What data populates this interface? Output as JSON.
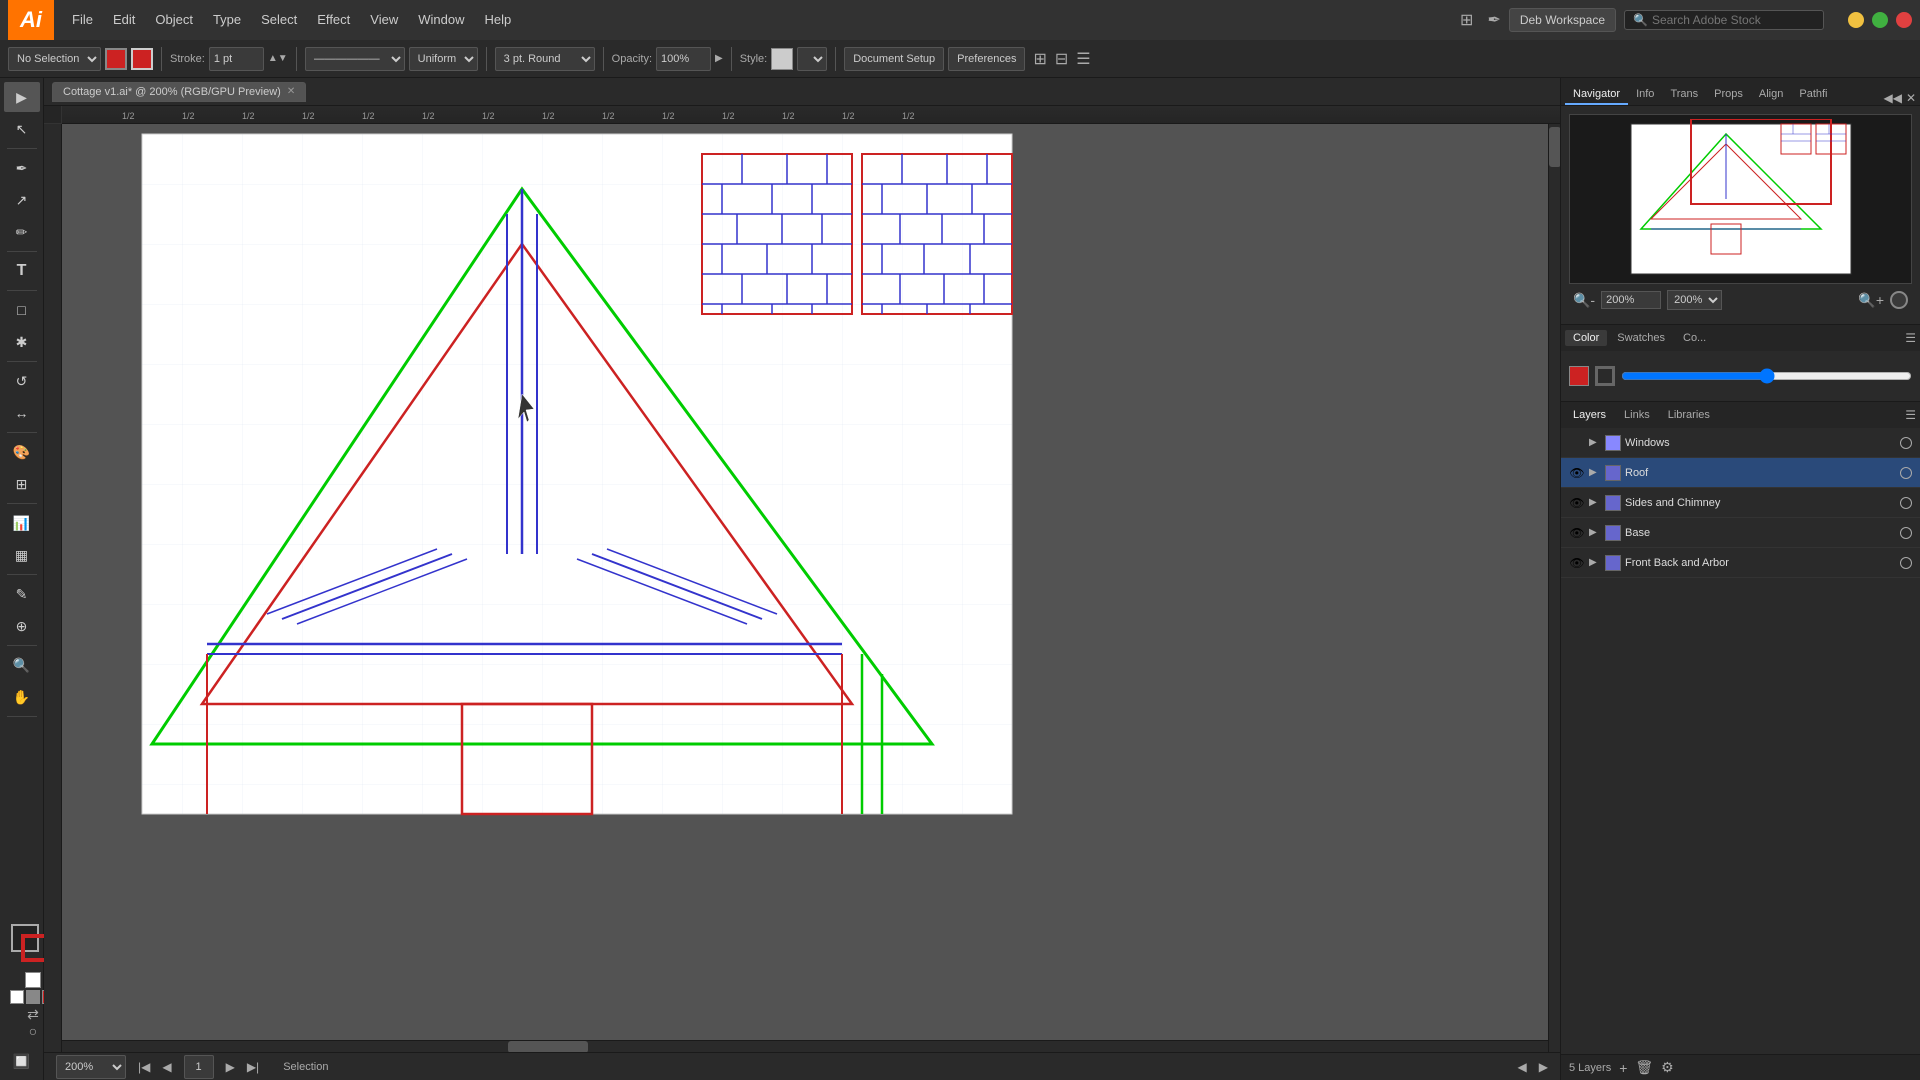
{
  "app": {
    "logo": "Ai",
    "title": "Adobe Illustrator"
  },
  "menubar": {
    "items": [
      "File",
      "Edit",
      "Object",
      "Type",
      "Select",
      "Effect",
      "View",
      "Window",
      "Help"
    ],
    "workspace": "Deb Workspace",
    "stock_search_placeholder": "Search Adobe Stock"
  },
  "toolbar": {
    "selection_label": "No Selection",
    "stroke_label": "Stroke:",
    "stroke_value": "1 pt",
    "uniform_label": "Uniform",
    "round_label": "3 pt. Round",
    "opacity_label": "Opacity:",
    "opacity_value": "100%",
    "style_label": "Style:",
    "doc_setup_label": "Document Setup",
    "preferences_label": "Preferences"
  },
  "document": {
    "tab_name": "Cottage v1.ai* @ 200% (RGB/GPU Preview)"
  },
  "status_bar": {
    "zoom": "200%",
    "page": "1",
    "tool": "Selection"
  },
  "right_panel": {
    "tabs": [
      "Navigator",
      "Info",
      "Trans",
      "Props",
      "Align",
      "Pathfi"
    ],
    "zoom_value": "200%",
    "sub_panel_tabs": [
      "Color",
      "Swatches",
      "Co..."
    ],
    "layers_tabs": [
      "Layers",
      "Links",
      "Libraries"
    ]
  },
  "layers": [
    {
      "name": "Windows",
      "visible": true,
      "active": false,
      "color": "#8888ff",
      "expanded": false
    },
    {
      "name": "Roof",
      "visible": true,
      "active": true,
      "color": "#6666cc",
      "expanded": false
    },
    {
      "name": "Sides and Chimney",
      "visible": true,
      "active": false,
      "color": "#6666cc",
      "expanded": false
    },
    {
      "name": "Base",
      "visible": true,
      "active": false,
      "color": "#6666cc",
      "expanded": false
    },
    {
      "name": "Front Back and Arbor",
      "visible": true,
      "active": false,
      "color": "#6666cc",
      "expanded": false
    }
  ],
  "layers_footer": {
    "count": "5 Layers"
  },
  "tools": [
    "▶",
    "↖",
    "✏",
    "↗",
    "✒",
    "T",
    "□",
    "✱",
    "〇",
    "✂",
    "↺",
    "↔",
    "⬛",
    "◻",
    "✦",
    "⊕",
    "📊",
    "▦",
    "✎",
    "🔭",
    "🔍",
    "✋",
    "🔲"
  ]
}
